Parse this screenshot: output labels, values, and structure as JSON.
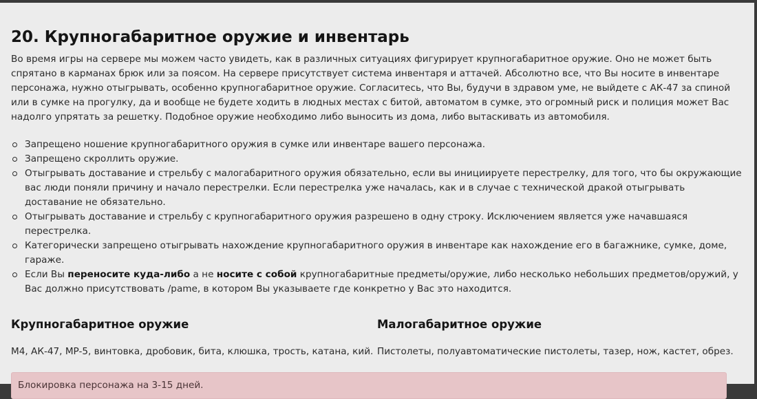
{
  "title": "20. Крупногабаритное оружие и инвентарь",
  "intro": "Во время игры на сервере мы можем часто увидеть, как в различных ситуациях фигурирует крупногабаритное оружие. Оно не может быть спрятано в карманах брюк или за поясом. На сервере присутствует система инвентаря и аттачей. Абсолютно все, что Вы носите в инвентаре персонажа, нужно отыгрывать, особенно крупногабаритное оружие. Согласитесь, что Вы, будучи в здравом уме, не выйдете с АК-47 за спиной или в сумке на прогулку, да и вообще не будете ходить в людных местах с битой, автоматом в сумке, это огромный риск и полиция может Вас надолго упрятать за решетку. Подобное оружие необходимо либо выносить из дома, либо вытаскивать из автомобиля.",
  "rules": [
    "Запрещено ношение крупногабаритного оружия в сумке или инвентаре вашего персонажа.",
    "Запрещено скроллить оружие.",
    "Отыгрывать доставание и стрельбу с малогабаритного оружия обязательно, если вы инициируете перестрелку, для того, что бы окружающие вас люди поняли причину и начало перестрелки. Если перестрелка уже началась, как и в случае с технической дракой отыгрывать доставание не обязательно.",
    "Отыгрывать доставание и стрельбу с крупногабаритного оружия разрешено в одну строку. Исключением является уже начавшаяся перестрелка.",
    "Категорически запрещено отыгрывать нахождение крупногабаритного оружия в инвентаре как нахождение его в багажнике, сумке, доме, гараже."
  ],
  "rule6": {
    "part1": "Если Вы ",
    "bold1": "переносите куда-либо",
    "part2": " а не ",
    "bold2": "носите с собой",
    "part3": " крупногабаритные предметы/оружие, либо несколько небольших предметов/оружий, у Вас должно присутствовать /pame, в котором Вы указываете где конкретно у Вас это находится."
  },
  "large_weapons": {
    "heading": "Крупногабаритное оружие",
    "items": "М4, АК-47, MP-5, винтовка, дробовик, бита, клюшка, трость, катана, кий."
  },
  "small_weapons": {
    "heading": "Малогабаритное оружие",
    "items": "Пистолеты, полуавтоматические пистолеты, тазер, нож, кастет, обрез."
  },
  "penalty": "Блокировка персонажа на 3-15 дней.",
  "colors": {
    "page_background": "#ececec",
    "outer_frame": "#3a3a3a",
    "alert_background": "#e7c5c8"
  }
}
